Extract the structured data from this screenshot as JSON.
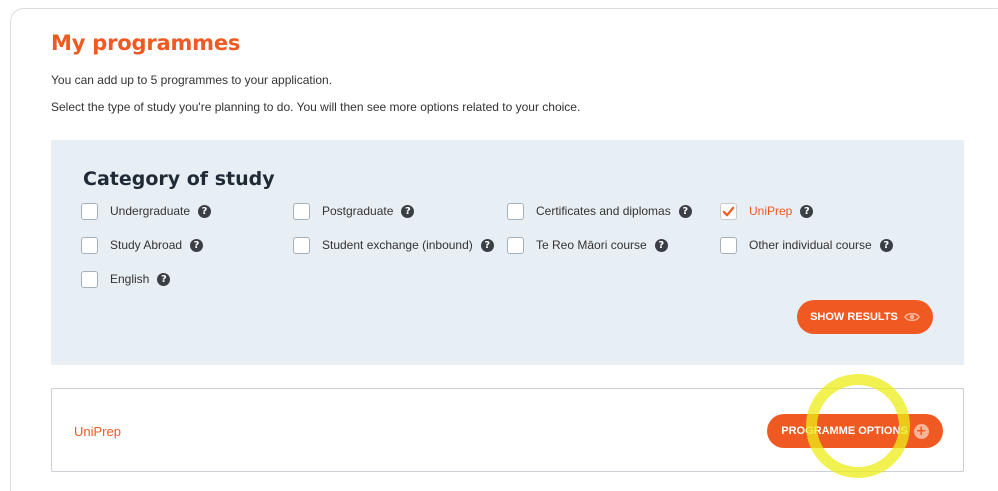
{
  "header": {
    "title": "My programmes",
    "intro_line1": "You can add up to 5 programmes to your application.",
    "intro_line2": "Select the type of study you're planning to do. You will then see more options related to your choice."
  },
  "category": {
    "title": "Category of study",
    "options": [
      {
        "label": "Undergraduate",
        "checked": false
      },
      {
        "label": "Postgraduate",
        "checked": false
      },
      {
        "label": "Certificates and diplomas",
        "checked": false
      },
      {
        "label": "UniPrep",
        "checked": true
      },
      {
        "label": "Study Abroad",
        "checked": false
      },
      {
        "label": "Student exchange (inbound)",
        "checked": false
      },
      {
        "label": "Te Reo Māori course",
        "checked": false
      },
      {
        "label": "Other individual course",
        "checked": false
      },
      {
        "label": "English",
        "checked": false
      }
    ],
    "help_icon_glyph": "?",
    "show_results_label": "SHOW RESULTS"
  },
  "result": {
    "selected_programme": "UniPrep",
    "programme_options_label": "PROGRAMME OPTIONS",
    "plus_glyph": "+"
  },
  "colors": {
    "accent": "#f05a22",
    "panel_bg": "#e7eef4",
    "highlight": "#ecec18"
  }
}
